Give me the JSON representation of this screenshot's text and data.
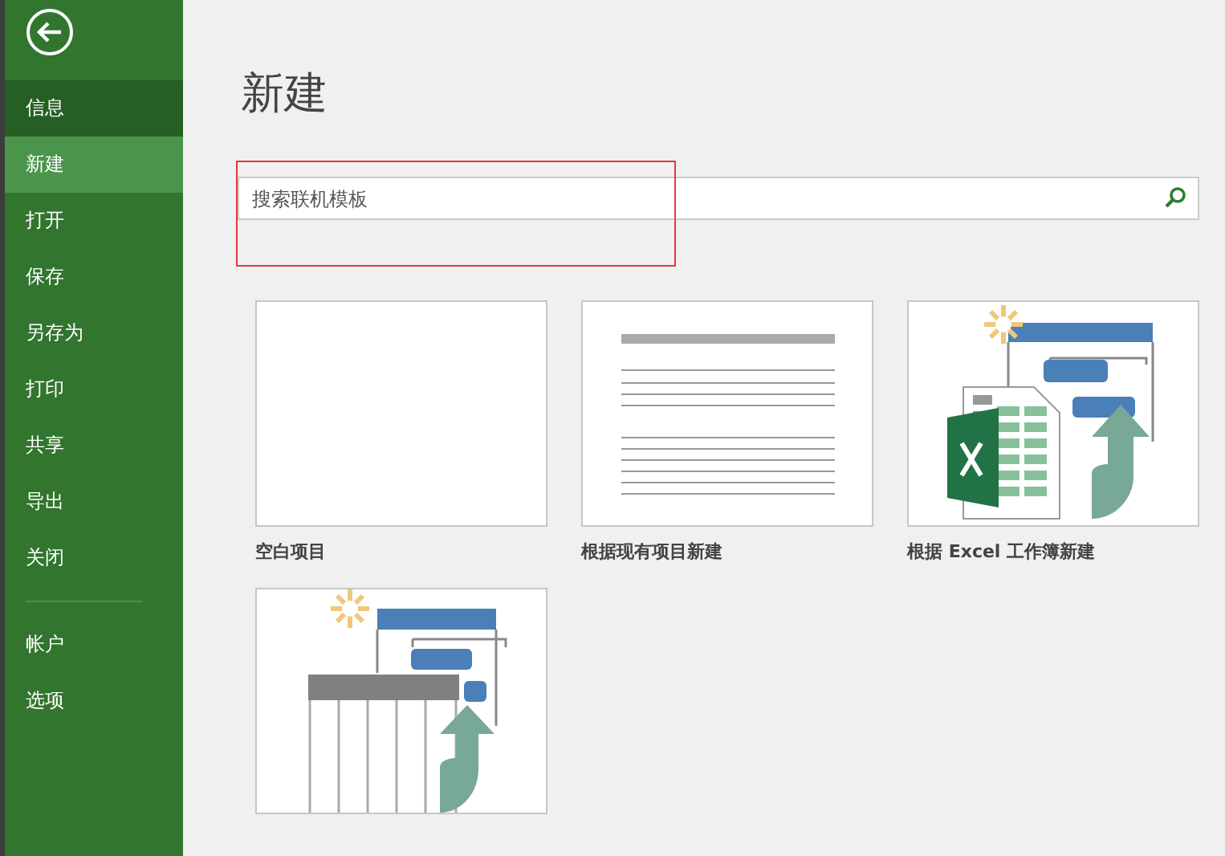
{
  "sidebar": {
    "items": [
      {
        "label": "信息",
        "selected": false,
        "hovered": true
      },
      {
        "label": "新建",
        "selected": true,
        "hovered": false
      },
      {
        "label": "打开",
        "selected": false,
        "hovered": false
      },
      {
        "label": "保存",
        "selected": false,
        "hovered": false
      },
      {
        "label": "另存为",
        "selected": false,
        "hovered": false
      },
      {
        "label": "打印",
        "selected": false,
        "hovered": false
      },
      {
        "label": "共享",
        "selected": false,
        "hovered": false
      },
      {
        "label": "导出",
        "selected": false,
        "hovered": false
      },
      {
        "label": "关闭",
        "selected": false,
        "hovered": false
      }
    ],
    "footer_items": [
      {
        "label": "帐户",
        "selected": false,
        "hovered": false
      },
      {
        "label": "选项",
        "selected": false,
        "hovered": false
      }
    ]
  },
  "page": {
    "title": "新建",
    "search": {
      "placeholder": "搜索联机模板",
      "highlighted": true
    },
    "templates": [
      {
        "kind": "blank",
        "label": "空白项目"
      },
      {
        "kind": "existing",
        "label": "根据现有项目新建"
      },
      {
        "kind": "excel",
        "label": "根据 Excel 工作簿新建"
      },
      {
        "kind": "sheet"
      }
    ]
  }
}
